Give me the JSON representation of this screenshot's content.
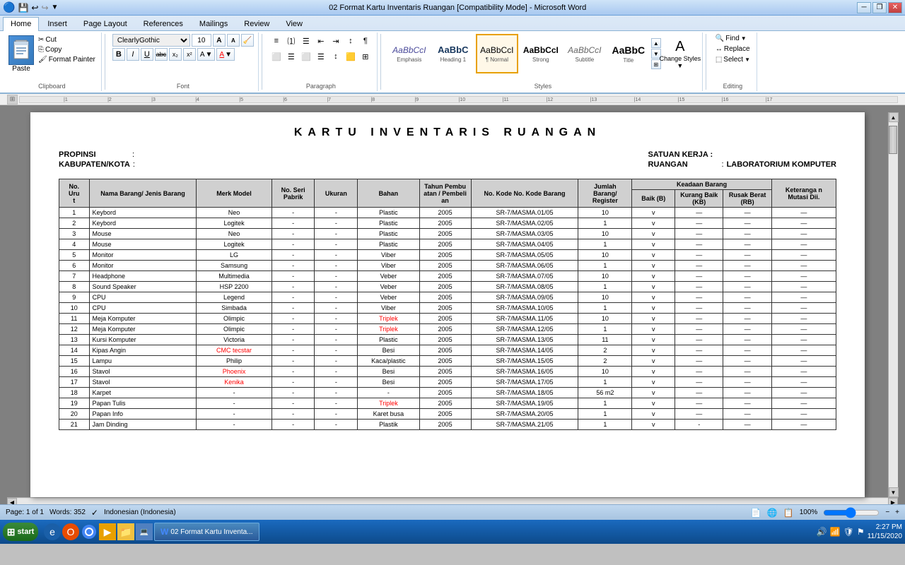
{
  "titlebar": {
    "title": "02 Format Kartu Inventaris Ruangan [Compatibility Mode] - Microsoft Word",
    "minimize": "─",
    "restore": "❐",
    "close": "✕"
  },
  "quickaccess": {
    "save": "💾",
    "undo": "↩",
    "redo": "↪"
  },
  "tabs": [
    "Home",
    "Insert",
    "Page Layout",
    "References",
    "Mailings",
    "Review",
    "View"
  ],
  "activeTab": "Home",
  "ribbon": {
    "clipboard": {
      "label": "Clipboard",
      "paste": "Paste",
      "cut": "Cut",
      "copy": "Copy",
      "formatPainter": "Format Painter"
    },
    "font": {
      "label": "Font",
      "fontName": "ClearlyGothic",
      "fontSize": "10",
      "bold": "B",
      "italic": "I",
      "underline": "U",
      "strikethrough": "ab̶c",
      "subscript": "x₂",
      "superscript": "x²"
    },
    "paragraph": {
      "label": "Paragraph"
    },
    "styles": {
      "label": "Styles",
      "items": [
        {
          "name": "Emphasis",
          "class": "emphasis"
        },
        {
          "name": "Heading 1",
          "class": "heading1"
        },
        {
          "name": "¶ Normal",
          "class": "normal",
          "active": true
        },
        {
          "name": "Strong",
          "class": "strong"
        },
        {
          "name": "Subtitle",
          "class": "subtitle"
        },
        {
          "name": "Title",
          "class": "title"
        }
      ],
      "changeStyles": "Change Styles",
      "changeStylesArrow": "▼"
    },
    "editing": {
      "label": "Editing",
      "find": "Find",
      "replace": "Replace",
      "select": "Select"
    }
  },
  "document": {
    "title": "KARTU   INVENTARIS   RUANGAN",
    "propinsi_label": "PROPINSI",
    "propinsi_colon": ":",
    "kabupaten_label": "KABUPATEN/KOTA",
    "kabupaten_colon": ":",
    "satuanKerja_label": "SATUAN KERJA :",
    "ruangan_label": "RUANGAN",
    "ruangan_colon": ":",
    "ruangan_value": "LABORATORIUM KOMPUTER",
    "table": {
      "headers": {
        "no_urut": "No. Uru t",
        "nama_barang": "Nama Barang/ Jenis Barang",
        "merk_model": "Merk Model",
        "no_seri": "No. Seri Pabrik",
        "ukuran": "Ukuran",
        "bahan": "Bahan",
        "tahun": "Tahun Pembu atan / Pembeli an",
        "no_kode": "No. Kode No. Kode Barang",
        "jumlah": "Jumlah Barang/ Register",
        "keadaan_label": "Keadaan Barang",
        "baik": "Baik (B)",
        "kurang_baik": "Kurang Baik (KB)",
        "rusak_berat": "Rusak Berat (RB)",
        "keterangan": "Keteranga n Mutasi Dii."
      },
      "rows": [
        {
          "no": 1,
          "nama": "Keybord",
          "merk": "Neo",
          "seri": "-",
          "ukuran": "-",
          "bahan": "Plastic",
          "tahun": "2005",
          "kode": "SR-7/MASMA.01/05",
          "jumlah": "10",
          "baik": "v",
          "kb": "—",
          "rb": "—",
          "ket": "—"
        },
        {
          "no": 2,
          "nama": "Keybord",
          "merk": "Logitek",
          "seri": "-",
          "ukuran": "-",
          "bahan": "Plastic",
          "tahun": "2005",
          "kode": "SR-7/MASMA.02/05",
          "jumlah": "1",
          "baik": "v",
          "kb": "—",
          "rb": "—",
          "ket": "—"
        },
        {
          "no": 3,
          "nama": "Mouse",
          "merk": "Neo",
          "seri": "-",
          "ukuran": "-",
          "bahan": "Plastic",
          "tahun": "2005",
          "kode": "SR-7/MASMA.03/05",
          "jumlah": "10",
          "baik": "v",
          "kb": "—",
          "rb": "—",
          "ket": "—"
        },
        {
          "no": 4,
          "nama": "Mouse",
          "merk": "Logitek",
          "seri": "-",
          "ukuran": "-",
          "bahan": "Plastic",
          "tahun": "2005",
          "kode": "SR-7/MASMA.04/05",
          "jumlah": "1",
          "baik": "v",
          "kb": "—",
          "rb": "—",
          "ket": "—"
        },
        {
          "no": 5,
          "nama": "Monitor",
          "merk": "LG",
          "seri": "-",
          "ukuran": "-",
          "bahan": "Viber",
          "tahun": "2005",
          "kode": "SR-7/MASMA.05/05",
          "jumlah": "10",
          "baik": "v",
          "kb": "—",
          "rb": "—",
          "ket": "—"
        },
        {
          "no": 6,
          "nama": "Monitor",
          "merk": "Samsung",
          "seri": "-",
          "ukuran": "-",
          "bahan": "Viber",
          "tahun": "2005",
          "kode": "SR-7/MASMA.06/05",
          "jumlah": "1",
          "baik": "v",
          "kb": "—",
          "rb": "—",
          "ket": "—"
        },
        {
          "no": 7,
          "nama": "Headphone",
          "merk": "Multimedia",
          "seri": "-",
          "ukuran": "-",
          "bahan": "Veber",
          "tahun": "2005",
          "kode": "SR-7/MASMA.07/05",
          "jumlah": "10",
          "baik": "v",
          "kb": "—",
          "rb": "—",
          "ket": "—"
        },
        {
          "no": 8,
          "nama": "Sound Speaker",
          "merk": "HSP 2200",
          "seri": "-",
          "ukuran": "-",
          "bahan": "Veber",
          "tahun": "2005",
          "kode": "SR-7/MASMA.08/05",
          "jumlah": "1",
          "baik": "v",
          "kb": "—",
          "rb": "—",
          "ket": "—"
        },
        {
          "no": 9,
          "nama": "CPU",
          "merk": "Legend",
          "seri": "-",
          "ukuran": "-",
          "bahan": "Veber",
          "tahun": "2005",
          "kode": "SR-7/MASMA.09/05",
          "jumlah": "10",
          "baik": "v",
          "kb": "—",
          "rb": "—",
          "ket": "—"
        },
        {
          "no": 10,
          "nama": "CPU",
          "merk": "Simbada",
          "seri": "-",
          "ukuran": "-",
          "bahan": "Viber",
          "tahun": "2005",
          "kode": "SR-7/MASMA.10/05",
          "jumlah": "1",
          "baik": "v",
          "kb": "—",
          "rb": "—",
          "ket": "—"
        },
        {
          "no": 11,
          "nama": "Meja Komputer",
          "merk": "Olimpic",
          "seri": "-",
          "ukuran": "-",
          "bahan_red": true,
          "bahan": "Triplek",
          "tahun": "2005",
          "kode": "SR-7/MASMA.11/05",
          "jumlah": "10",
          "baik": "v",
          "kb": "—",
          "rb": "—",
          "ket": "—"
        },
        {
          "no": 12,
          "nama": "Meja Komputer",
          "merk": "Olimpic",
          "seri": "-",
          "ukuran": "-",
          "bahan_red": true,
          "bahan": "Triplek",
          "tahun": "2005",
          "kode": "SR-7/MASMA.12/05",
          "jumlah": "1",
          "baik": "v",
          "kb": "—",
          "rb": "—",
          "ket": "—"
        },
        {
          "no": 13,
          "nama": "Kursi Komputer",
          "merk": "Victoria",
          "seri": "-",
          "ukuran": "-",
          "bahan": "Plastic",
          "tahun": "2005",
          "kode": "SR-7/MASMA.13/05",
          "jumlah": "11",
          "baik": "v",
          "kb": "—",
          "rb": "—",
          "ket": "—"
        },
        {
          "no": 14,
          "nama": "Kipas Angin",
          "merk_red": true,
          "merk": "CMC tecstar",
          "seri": "-",
          "ukuran": "-",
          "bahan": "Besi",
          "tahun": "2005",
          "kode": "SR-7/MASMA.14/05",
          "jumlah": "2",
          "baik": "v",
          "kb": "—",
          "rb": "—",
          "ket": "—"
        },
        {
          "no": 15,
          "nama": "Lampu",
          "merk": "Philip",
          "seri": "-",
          "ukuran": "-",
          "bahan": "Kaca/plastic",
          "tahun": "2005",
          "kode": "SR-7/MASMA.15/05",
          "jumlah": "2",
          "baik": "v",
          "kb": "—",
          "rb": "—",
          "ket": "—"
        },
        {
          "no": 16,
          "nama": "Stavol",
          "merk_red": true,
          "merk": "Phoenix",
          "seri": "-",
          "ukuran": "-",
          "bahan": "Besi",
          "tahun": "2005",
          "kode": "SR-7/MASMA.16/05",
          "jumlah": "10",
          "baik": "v",
          "kb": "—",
          "rb": "—",
          "ket": "—"
        },
        {
          "no": 17,
          "nama": "Stavol",
          "merk_red": true,
          "merk": "Kenika",
          "seri": "-",
          "ukuran": "-",
          "bahan": "Besi",
          "tahun": "2005",
          "kode": "SR-7/MASMA.17/05",
          "jumlah": "1",
          "baik": "v",
          "kb": "—",
          "rb": "—",
          "ket": "—"
        },
        {
          "no": 18,
          "nama": "Karpet",
          "merk": "-",
          "seri": "-",
          "ukuran": "-",
          "bahan": "-",
          "tahun": "2005",
          "kode": "SR-7/MASMA.18/05",
          "jumlah": "56 m2",
          "baik": "v",
          "kb": "—",
          "rb": "—",
          "ket": "—"
        },
        {
          "no": 19,
          "nama": "Papan Tulis",
          "merk": "-",
          "seri": "-",
          "ukuran": "-",
          "bahan_red": true,
          "bahan": "Triplek",
          "tahun": "2005",
          "kode": "SR-7/MASMA.19/05",
          "jumlah": "1",
          "baik": "v",
          "kb": "—",
          "rb": "—",
          "ket": "—"
        },
        {
          "no": 20,
          "nama": "Papan Info",
          "merk": "-",
          "seri": "-",
          "ukuran": "-",
          "bahan": "Karet busa",
          "tahun": "2005",
          "kode": "SR-7/MASMA.20/05",
          "jumlah": "1",
          "baik": "v",
          "kb": "—",
          "rb": "—",
          "ket": "—"
        },
        {
          "no": 21,
          "nama": "Jam Dinding",
          "merk": "-",
          "seri": "-",
          "ukuran": "-",
          "bahan": "Plastik",
          "tahun": "2005",
          "kode": "SR-7/MASMA.21/05",
          "jumlah": "1",
          "baik": "v",
          "kb": "-",
          "rb": "—",
          "ket": "—"
        }
      ]
    }
  },
  "statusbar": {
    "page": "Page: 1 of 1",
    "words": "Words: 352",
    "language": "Indonesian (Indonesia)",
    "zoom": "100%"
  },
  "taskbar": {
    "start_label": "start",
    "time": "2:27 PM",
    "date": "11/15/2020",
    "active_window": "02 Format Kartu Inventa..."
  }
}
